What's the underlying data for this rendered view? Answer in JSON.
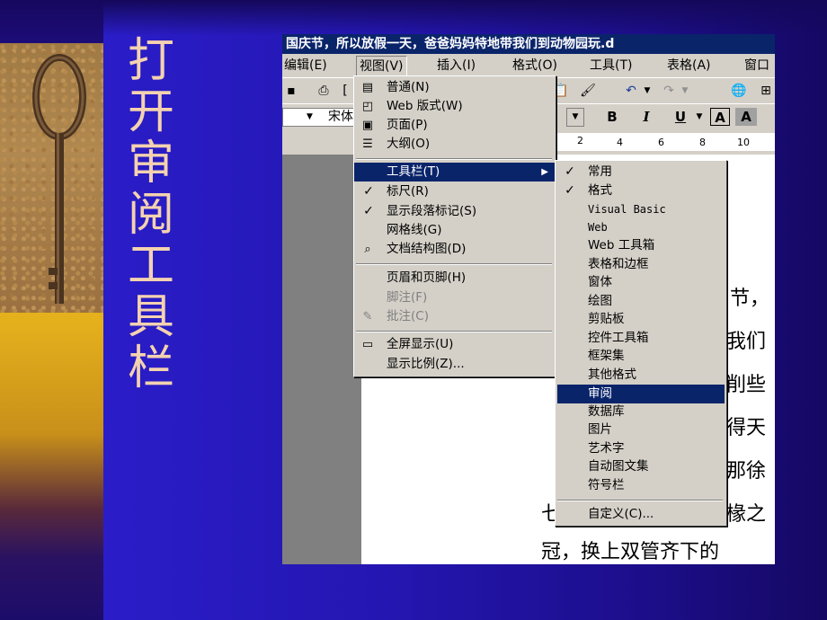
{
  "title_chars": [
    "打",
    "开",
    "审",
    "阅",
    "工",
    "具",
    "栏"
  ],
  "word": {
    "title_bar": "国庆节，所以放假一天，爸爸妈妈特地带我们到动物园玩.d",
    "menubar": [
      "编辑(E)",
      "视图(V)",
      "插入(I)",
      "格式(O)",
      "工具(T)",
      "表格(A)",
      "窗口"
    ],
    "font_name": "宋体",
    "format_buttons": [
      "B",
      "I",
      "U",
      "A",
      "A"
    ],
    "ruler_numbers": [
      "2",
      "4",
      "6",
      "8",
      "10"
    ],
    "doc_lines": [
      "节，",
      "我们",
      "削些",
      "得天",
      "那徐",
      "七",
      "椽之",
      "冠，换上双管齐下的"
    ]
  },
  "view_menu": {
    "items": [
      {
        "label": "普通(N)",
        "icon": "normal-view-icon"
      },
      {
        "label": "Web 版式(W)",
        "icon": "web-layout-icon"
      },
      {
        "label": "页面(P)",
        "icon": "page-layout-icon"
      },
      {
        "label": "大纲(O)",
        "icon": "outline-view-icon"
      },
      {
        "label": "工具栏(T)",
        "highlighted": true,
        "submenu": true
      },
      {
        "label": "标尺(R)",
        "checked": true
      },
      {
        "label": "显示段落标记(S)",
        "checked": true
      },
      {
        "label": "网格线(G)"
      },
      {
        "label": "文档结构图(D)",
        "icon": "document-map-icon"
      },
      {
        "label": "页眉和页脚(H)"
      },
      {
        "label": "脚注(F)",
        "disabled": true
      },
      {
        "label": "批注(C)",
        "disabled": true,
        "icon": "comments-icon"
      },
      {
        "label": "全屏显示(U)",
        "icon": "full-screen-icon"
      },
      {
        "label": "显示比例(Z)..."
      }
    ]
  },
  "toolbars_submenu": {
    "items": [
      {
        "label": "常用",
        "checked": true
      },
      {
        "label": "格式",
        "checked": true
      },
      {
        "label": "Visual Basic"
      },
      {
        "label": "Web"
      },
      {
        "label": "Web 工具箱"
      },
      {
        "label": "表格和边框"
      },
      {
        "label": "窗体"
      },
      {
        "label": "绘图"
      },
      {
        "label": "剪贴板"
      },
      {
        "label": "控件工具箱"
      },
      {
        "label": "框架集"
      },
      {
        "label": "其他格式"
      },
      {
        "label": "审阅",
        "highlighted": true
      },
      {
        "label": "数据库"
      },
      {
        "label": "图片"
      },
      {
        "label": "艺术字"
      },
      {
        "label": "自动图文集"
      },
      {
        "label": "符号栏"
      },
      {
        "label": "自定义(C)..."
      }
    ]
  }
}
